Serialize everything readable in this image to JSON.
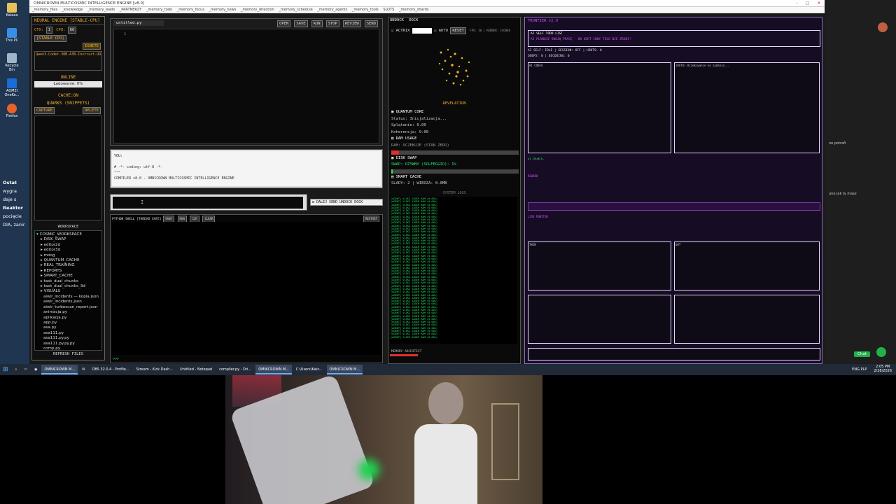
{
  "window": {
    "title": "OMNICROWN MULTICOSMIC INTELLIGENCE ENGINE [v8.0]",
    "menu": [
      "_memory_files",
      "_knowledge",
      "_memory_leads",
      "_PARTNERZY",
      "_memory_todo",
      "_memory_focus",
      "_memory_news",
      "_memory_direction",
      "_memory_schedule",
      "_memory_agents",
      "_memory_tools",
      "SLOTS",
      "_memory_shards"
    ]
  },
  "desktop": {
    "icons": [
      {
        "label": "Kaiaaa",
        "icon": "folder-icon"
      },
      {
        "label": "This PC",
        "icon": "computer-icon"
      },
      {
        "label": "Recycle Bin",
        "icon": "trash-icon"
      },
      {
        "label": "AOMEI OneKe...",
        "icon": "app-icon"
      },
      {
        "label": "Firefox",
        "icon": "firefox-icon"
      }
    ],
    "chat_fragment": [
      "Ostat",
      "wygra",
      "daje s",
      "Reaktor",
      "pocięcie",
      "DIA, zanir"
    ]
  },
  "sidebar": {
    "title": "NEURAL ENGINE [STABLE-CPU]",
    "ctx_label": "CTX:",
    "ctx_value": "1",
    "cpu_label": "CPU:",
    "cpu_value": "66",
    "stable_label": "[STABLE CPU]",
    "ignite": "IGNITE",
    "model": "Qwen3-Coder-30B-A3B-Instruct-UD-Q8_",
    "status": "ONLINE",
    "loading": "Ładowanie: 0%",
    "cache": "CACHE:ON",
    "quarks_title": "QUARKS (SNIPPETS)",
    "capture": "CAPTURE",
    "delete": "DELETE",
    "workspace_title": "WORKSPACE",
    "workspace_root": "COSMIC_WORKSPACE",
    "workspace_items": [
      "DISK_SWAP",
      "editor2d",
      "editor3d",
      "moog",
      "QUANTUM_CACHE",
      "REAL_TRAINING",
      "REPORTS",
      "SMART_CACHE",
      "task_dual_chunks",
      "task_dual_chunks_3d",
      "VISUALS",
      "aiwir_incidents — kopia.json",
      "aiwir_incidents.json",
      "aiwir_turboscan_report.json",
      "animacja.py",
      "aplikacja.py",
      "app.py",
      "asa.py",
      "asa111.py",
      "asa111.py.py",
      "asa111.py.py.py",
      "comp.py"
    ],
    "refresh": "REFRESH FILES"
  },
  "editor": {
    "tab": "untitled.py",
    "buttons": [
      "OPEN",
      "SAVE",
      "RUN",
      "STOP",
      "REVIEW",
      "SEND"
    ],
    "line_number": "1"
  },
  "console": {
    "you_label": "YOU:",
    "lines": [
      "# -*- coding: utf-8 -*-",
      "\"\"\"",
      "COMPILER v8.0 - OMNICROWN MULTICOSMIC INTELLIGENCE ENGINE"
    ]
  },
  "input": {
    "placeholder": "",
    "buttons": [
      "DALEJ",
      "SEND",
      "UNDOCK",
      "DOCK"
    ]
  },
  "shell": {
    "title": "PYTHON SHELL [THREAD SAFE]",
    "buttons": [
      "SAVE",
      "RUN",
      "CLR",
      "CLEAR"
    ],
    "right_button": "RESTART",
    "prompt": ">>>"
  },
  "middle": {
    "undock": "UNDOCK",
    "dock": "DOCK",
    "actrix": "ACTRIX",
    "auto": "AUTO",
    "reset": "RESET",
    "fps": "FPS: 30 | RENDER: CACHED",
    "visual_label": "REVELATION",
    "core_title": "QUANTUM CORE",
    "core_lines": [
      "Status: Inicjalizacja...",
      "Splątanie: 0.00",
      "Koherencja: 0.00"
    ],
    "ram_title": "RAM USAGE",
    "ram_value": "RAM: OCZEKUJE (STAN ZERO)",
    "swap_title": "DISK SWAP",
    "swap_value": "SWAP: OŻYWNY (SOLFEGGIO): 1%",
    "smart_title": "SMART CACHE",
    "smart_value": "SLADY: 2 | WIEDZA: 0.0MB",
    "logs_title": "SYSTEM LOGS",
    "log_sample": "[AGENT] VLIKI ZAGER RAM (0.00%)",
    "footer": "MEMORY ARCHITECT"
  },
  "right": {
    "title": "FRONTIER v2.0",
    "panels": [
      "AI SELF TODO LIST",
      "AI PLANUJE SWOJĄ PRACĘ - BO NIKT INNY TEGO NIE ZROBI!",
      "AI SELF: IDLE | SESSION: OFF | HINTS: 0",
      "QUERY: 0 | DECODING: 0",
      "AI CODEX",
      "AI COUNCIL",
      "REWARD",
      "LIVE MONITOR",
      "TWIN",
      "OUT"
    ],
    "panel_body": "[DATA] Oczekiwanie na zadania..."
  },
  "taskbar": {
    "items": [
      "OMNICROWN M...",
      "OBS 32.0.4 - Profile...",
      "Stream - Kick Dash...",
      "Untitled - Notepad",
      "compiler.py - Dri...",
      "OMNICROWN M...",
      "C:\\Users\\Kaiz...",
      "OMNICROWN M..."
    ],
    "clock": "2:05 PM",
    "date": "2/28/2026",
    "lang": "ENG PLP"
  },
  "browser_panel": {
    "texts": [
      "ne potrafi",
      "uno jak ty masz"
    ],
    "chat_button": "Chat"
  },
  "colors": {
    "accent_gold": "#f0b030",
    "terminal_green": "#2ee86a",
    "magenta": "#d04fff",
    "purple_bg": "#160c24"
  }
}
